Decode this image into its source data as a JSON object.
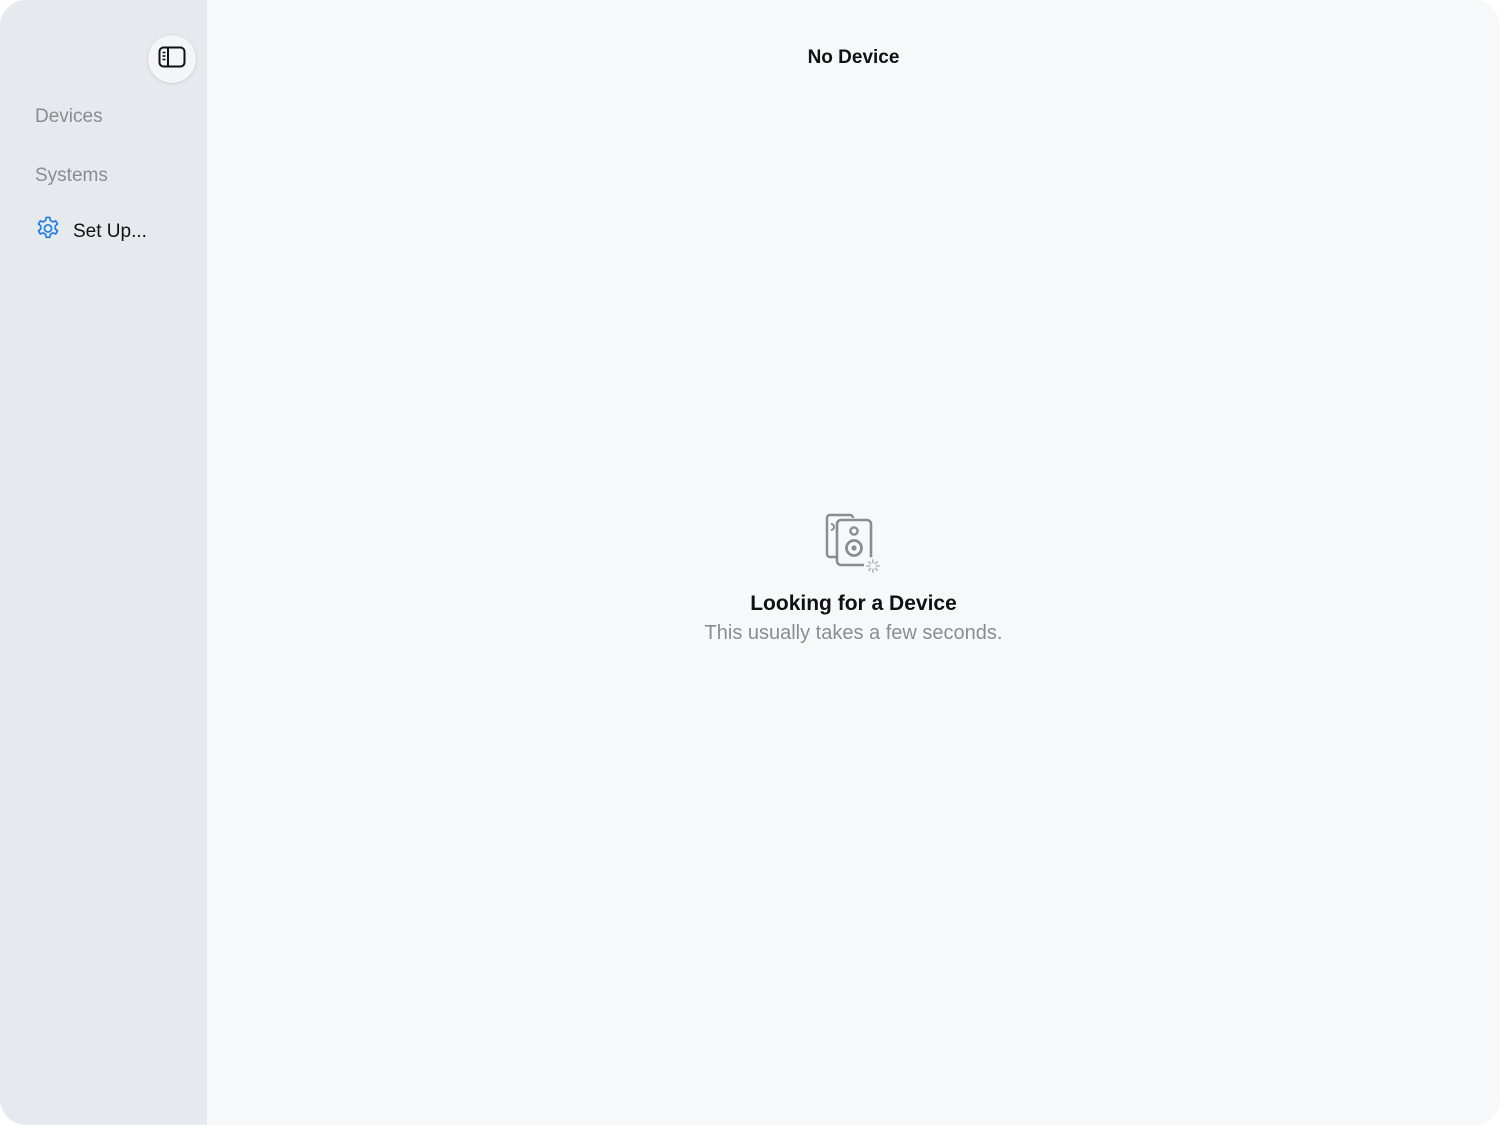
{
  "sidebar": {
    "toggle_icon": "sidebar-toggle-icon",
    "sections": [
      {
        "label": "Devices"
      },
      {
        "label": "Systems"
      }
    ],
    "setup": {
      "label": "Set Up...",
      "icon": "gear-icon",
      "icon_color": "#1f7fe0"
    }
  },
  "main": {
    "nav_title": "No Device",
    "empty_state": {
      "icon": "speakers-searching-icon",
      "title": "Looking for a Device",
      "subtitle": "This usually takes a few seconds."
    }
  },
  "colors": {
    "sidebar_bg": "#e6e9ed",
    "main_bg": "#f7f8fa",
    "accent": "#1f7fe0",
    "secondary_text": "#8a8c90"
  }
}
